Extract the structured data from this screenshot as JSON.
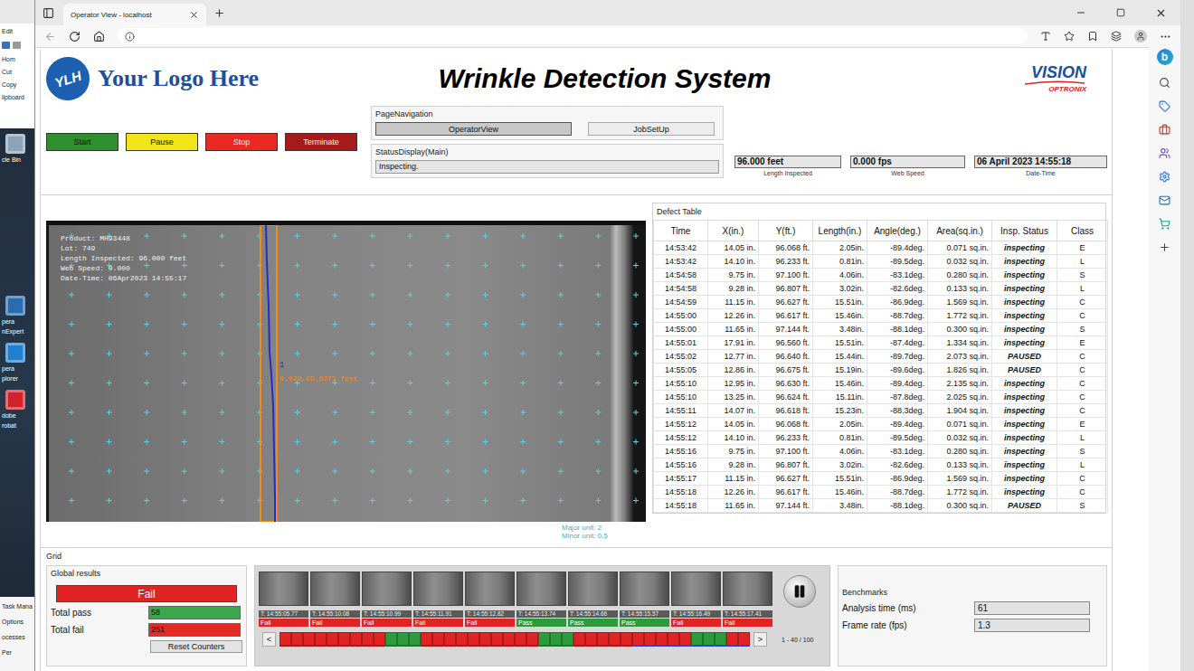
{
  "desktop": {
    "ribbon": [
      "Edit",
      "Hom",
      "Cut",
      "Copy",
      "lipboard"
    ],
    "icons": [
      {
        "lines": [
          "cle Bin"
        ],
        "color": "#8fa3b8"
      },
      {
        "lines": [
          "pera",
          "nExpert"
        ],
        "color": "#2b6cb0"
      },
      {
        "lines": [
          "pera",
          "plorer"
        ],
        "color": "#1f7fd1"
      },
      {
        "lines": [
          "dobe",
          "robat"
        ],
        "color": "#d4202a"
      }
    ],
    "task_manager": [
      "Task Mana",
      "Options",
      "ocesses",
      "Per"
    ]
  },
  "browser": {
    "tab": {
      "title": "Operator View - localhost",
      "selected": true
    },
    "sidebar_logo": "b"
  },
  "header": {
    "logo_mark": "YLH",
    "logo_text": "Your Logo Here",
    "title": "Wrinkle Detection System",
    "brand": "VISION",
    "brand_sub": "OPTRONIX"
  },
  "controls": [
    {
      "label": "Start",
      "color": "#2f8f2f"
    },
    {
      "label": "Pause",
      "color": "#f2e61a"
    },
    {
      "label": "Stop",
      "color": "#ea2a22"
    },
    {
      "label": "Terminate",
      "color": "#a51b1b"
    }
  ],
  "page_navigation": {
    "title": "PageNavigation",
    "items": [
      {
        "label": "OperatorView",
        "selected": true
      },
      {
        "label": "JobSetUp",
        "selected": false
      }
    ]
  },
  "status_display": {
    "title": "StatusDisplay(Main)",
    "value": "Inspecting."
  },
  "readouts": [
    {
      "value": "96.000 feet",
      "label": "Length Inspected"
    },
    {
      "value": "0.000 fps",
      "label": "Web Speed"
    },
    {
      "value": "06 April 2023 14:55:18",
      "label": "Date-Time"
    }
  ],
  "camera": {
    "overlay": [
      "Product: MH93448",
      "Lot: 749",
      "Length Inspected: 96.000 feet",
      "Web Speed: 0.000",
      "Date-Time: 06Apr2023 14:55:17"
    ],
    "marker": "1",
    "label": "0.929,96.6271 feet",
    "units": [
      "Major unit: 2",
      "Minor unit: 0.5"
    ]
  },
  "defect_table": {
    "title": "Defect Table",
    "columns": [
      "Time",
      "X(in.)",
      "Y(ft.)",
      "Length(in.)",
      "Angle(deg.)",
      "Area(sq.in.)",
      "Insp. Status",
      "Class"
    ],
    "rows": [
      [
        "14:53:42",
        "14.05 in.",
        "96.068 ft.",
        "2.05in.",
        "-89.4deg.",
        "0.071 sq.in.",
        "inspecting",
        "E"
      ],
      [
        "14:53:42",
        "14.10 in.",
        "96.233 ft.",
        "0.81in.",
        "-89.5deg.",
        "0.032 sq.in.",
        "inspecting",
        "L"
      ],
      [
        "14:54:58",
        "9.75 in.",
        "97.100 ft.",
        "4.06in.",
        "-83.1deg.",
        "0.280 sq.in.",
        "inspecting",
        "S"
      ],
      [
        "14:54:58",
        "9.28 in.",
        "96.807 ft.",
        "3.02in.",
        "-82.6deg.",
        "0.133 sq.in.",
        "inspecting",
        "L"
      ],
      [
        "14:54:59",
        "11.15 in.",
        "96.627 ft.",
        "15.51in.",
        "-86.9deg.",
        "1.569 sq.in.",
        "inspecting",
        "C"
      ],
      [
        "14:55:00",
        "12.26 in.",
        "96.617 ft.",
        "15.46in.",
        "-88.7deg.",
        "1.772 sq.in.",
        "inspecting",
        "C"
      ],
      [
        "14:55:00",
        "11.65 in.",
        "97.144 ft.",
        "3.48in.",
        "-88.1deg.",
        "0.300 sq.in.",
        "inspecting",
        "S"
      ],
      [
        "14:55:01",
        "17.91 in.",
        "96.560 ft.",
        "15.51in.",
        "-87.4deg.",
        "1.334 sq.in.",
        "inspecting",
        "E"
      ],
      [
        "14:55:02",
        "12.77 in.",
        "96.640 ft.",
        "15.44in.",
        "-89.7deg.",
        "2.073 sq.in.",
        "PAUSED",
        "C"
      ],
      [
        "14:55:05",
        "12.86 in.",
        "96.675 ft.",
        "15.19in.",
        "-89.6deg.",
        "1.826 sq.in.",
        "PAUSED",
        "C"
      ],
      [
        "14:55:10",
        "12.95 in.",
        "96.630 ft.",
        "15.46in.",
        "-89.4deg.",
        "2.135 sq.in.",
        "inspecting",
        "C"
      ],
      [
        "14:55:10",
        "13.25 in.",
        "96.624 ft.",
        "15.11in.",
        "-87.8deg.",
        "2.025 sq.in.",
        "inspecting",
        "C"
      ],
      [
        "14:55:11",
        "14.07 in.",
        "96.618 ft.",
        "15.23in.",
        "-88.3deg.",
        "1.904 sq.in.",
        "inspecting",
        "C"
      ],
      [
        "14:55:12",
        "14.05 in.",
        "96.068 ft.",
        "2.05in.",
        "-89.4deg.",
        "0.071 sq.in.",
        "inspecting",
        "E"
      ],
      [
        "14:55:12",
        "14.10 in.",
        "96.233 ft.",
        "0.81in.",
        "-89.5deg.",
        "0.032 sq.in.",
        "inspecting",
        "L"
      ],
      [
        "14:55:16",
        "9.75 in.",
        "97.100 ft.",
        "4.06in.",
        "-83.1deg.",
        "0.280 sq.in.",
        "inspecting",
        "S"
      ],
      [
        "14:55:16",
        "9.28 in.",
        "96.807 ft.",
        "3.02in.",
        "-82.6deg.",
        "0.133 sq.in.",
        "inspecting",
        "L"
      ],
      [
        "14:55:17",
        "11.15 in.",
        "96.627 ft.",
        "15.51in.",
        "-86.9deg.",
        "1.569 sq.in.",
        "inspecting",
        "C"
      ],
      [
        "14:55:18",
        "12.26 in.",
        "96.617 ft.",
        "15.46in.",
        "-88.7deg.",
        "1.772 sq.in.",
        "inspecting",
        "C"
      ],
      [
        "14:55:18",
        "11.65 in.",
        "97.144 ft.",
        "3.48in.",
        "-88.1deg.",
        "0.300 sq.in.",
        "PAUSED",
        "S"
      ]
    ]
  },
  "grid": {
    "title": "Grid",
    "global": {
      "title": "Global results",
      "status": "Fail",
      "passed": false,
      "counters": [
        {
          "label": "Total pass",
          "value": "58",
          "color": "#3aa84a"
        },
        {
          "label": "Total fail",
          "value": "251",
          "color": "#e42a24"
        }
      ],
      "reset": "Reset Counters"
    },
    "thumbnails": [
      {
        "time": "T: 14:55:05.77",
        "result": "Fail",
        "passed": false
      },
      {
        "time": "T: 14:55:10.08",
        "result": "Fail",
        "passed": false
      },
      {
        "time": "T: 14:55:10.99",
        "result": "Fail",
        "passed": false
      },
      {
        "time": "T: 14:55:11.91",
        "result": "Fail",
        "passed": false
      },
      {
        "time": "T: 14:55:12.82",
        "result": "Fail",
        "passed": false
      },
      {
        "time": "T: 14:55:13.74",
        "result": "Pass",
        "passed": true
      },
      {
        "time": "T: 14:55:14.66",
        "result": "Pass",
        "passed": true
      },
      {
        "time": "T: 14:55:15.57",
        "result": "Pass",
        "passed": true
      },
      {
        "time": "T: 14:55:16.49",
        "result": "Fail",
        "passed": false
      },
      {
        "time": "T: 14:55:17.41",
        "result": "Fail",
        "passed": false
      }
    ],
    "strip": {
      "prev": "<",
      "next": ">",
      "counter": "1 - 40 / 100",
      "cells": [
        {
          "passed": false,
          "selected": false
        },
        {
          "passed": false,
          "selected": false
        },
        {
          "passed": false,
          "selected": false
        },
        {
          "passed": false,
          "selected": false
        },
        {
          "passed": false,
          "selected": false
        },
        {
          "passed": false,
          "selected": false
        },
        {
          "passed": false,
          "selected": false
        },
        {
          "passed": false,
          "selected": false
        },
        {
          "passed": false,
          "selected": false
        },
        {
          "passed": true,
          "selected": false
        },
        {
          "passed": true,
          "selected": false
        },
        {
          "passed": true,
          "selected": false
        },
        {
          "passed": false,
          "selected": false
        },
        {
          "passed": false,
          "selected": false
        },
        {
          "passed": false,
          "selected": false
        },
        {
          "passed": false,
          "selected": false
        },
        {
          "passed": false,
          "selected": false
        },
        {
          "passed": false,
          "selected": false
        },
        {
          "passed": false,
          "selected": false
        },
        {
          "passed": false,
          "selected": false
        },
        {
          "passed": false,
          "selected": false
        },
        {
          "passed": false,
          "selected": false
        },
        {
          "passed": true,
          "selected": false
        },
        {
          "passed": true,
          "selected": false
        },
        {
          "passed": true,
          "selected": false
        },
        {
          "passed": false,
          "selected": false
        },
        {
          "passed": false,
          "selected": false
        },
        {
          "passed": false,
          "selected": false
        },
        {
          "passed": false,
          "selected": false
        },
        {
          "passed": false,
          "selected": false
        },
        {
          "passed": false,
          "selected": true
        },
        {
          "passed": false,
          "selected": true
        },
        {
          "passed": false,
          "selected": true
        },
        {
          "passed": false,
          "selected": true
        },
        {
          "passed": false,
          "selected": true
        },
        {
          "passed": true,
          "selected": true
        },
        {
          "passed": true,
          "selected": true
        },
        {
          "passed": true,
          "selected": true
        },
        {
          "passed": false,
          "selected": true
        },
        {
          "passed": false,
          "selected": true
        }
      ]
    },
    "benchmarks": {
      "title": "Benchmarks",
      "rows": [
        {
          "label": "Analysis time (ms)",
          "value": "61"
        },
        {
          "label": "Frame rate (fps)",
          "value": "1.3"
        }
      ]
    }
  }
}
